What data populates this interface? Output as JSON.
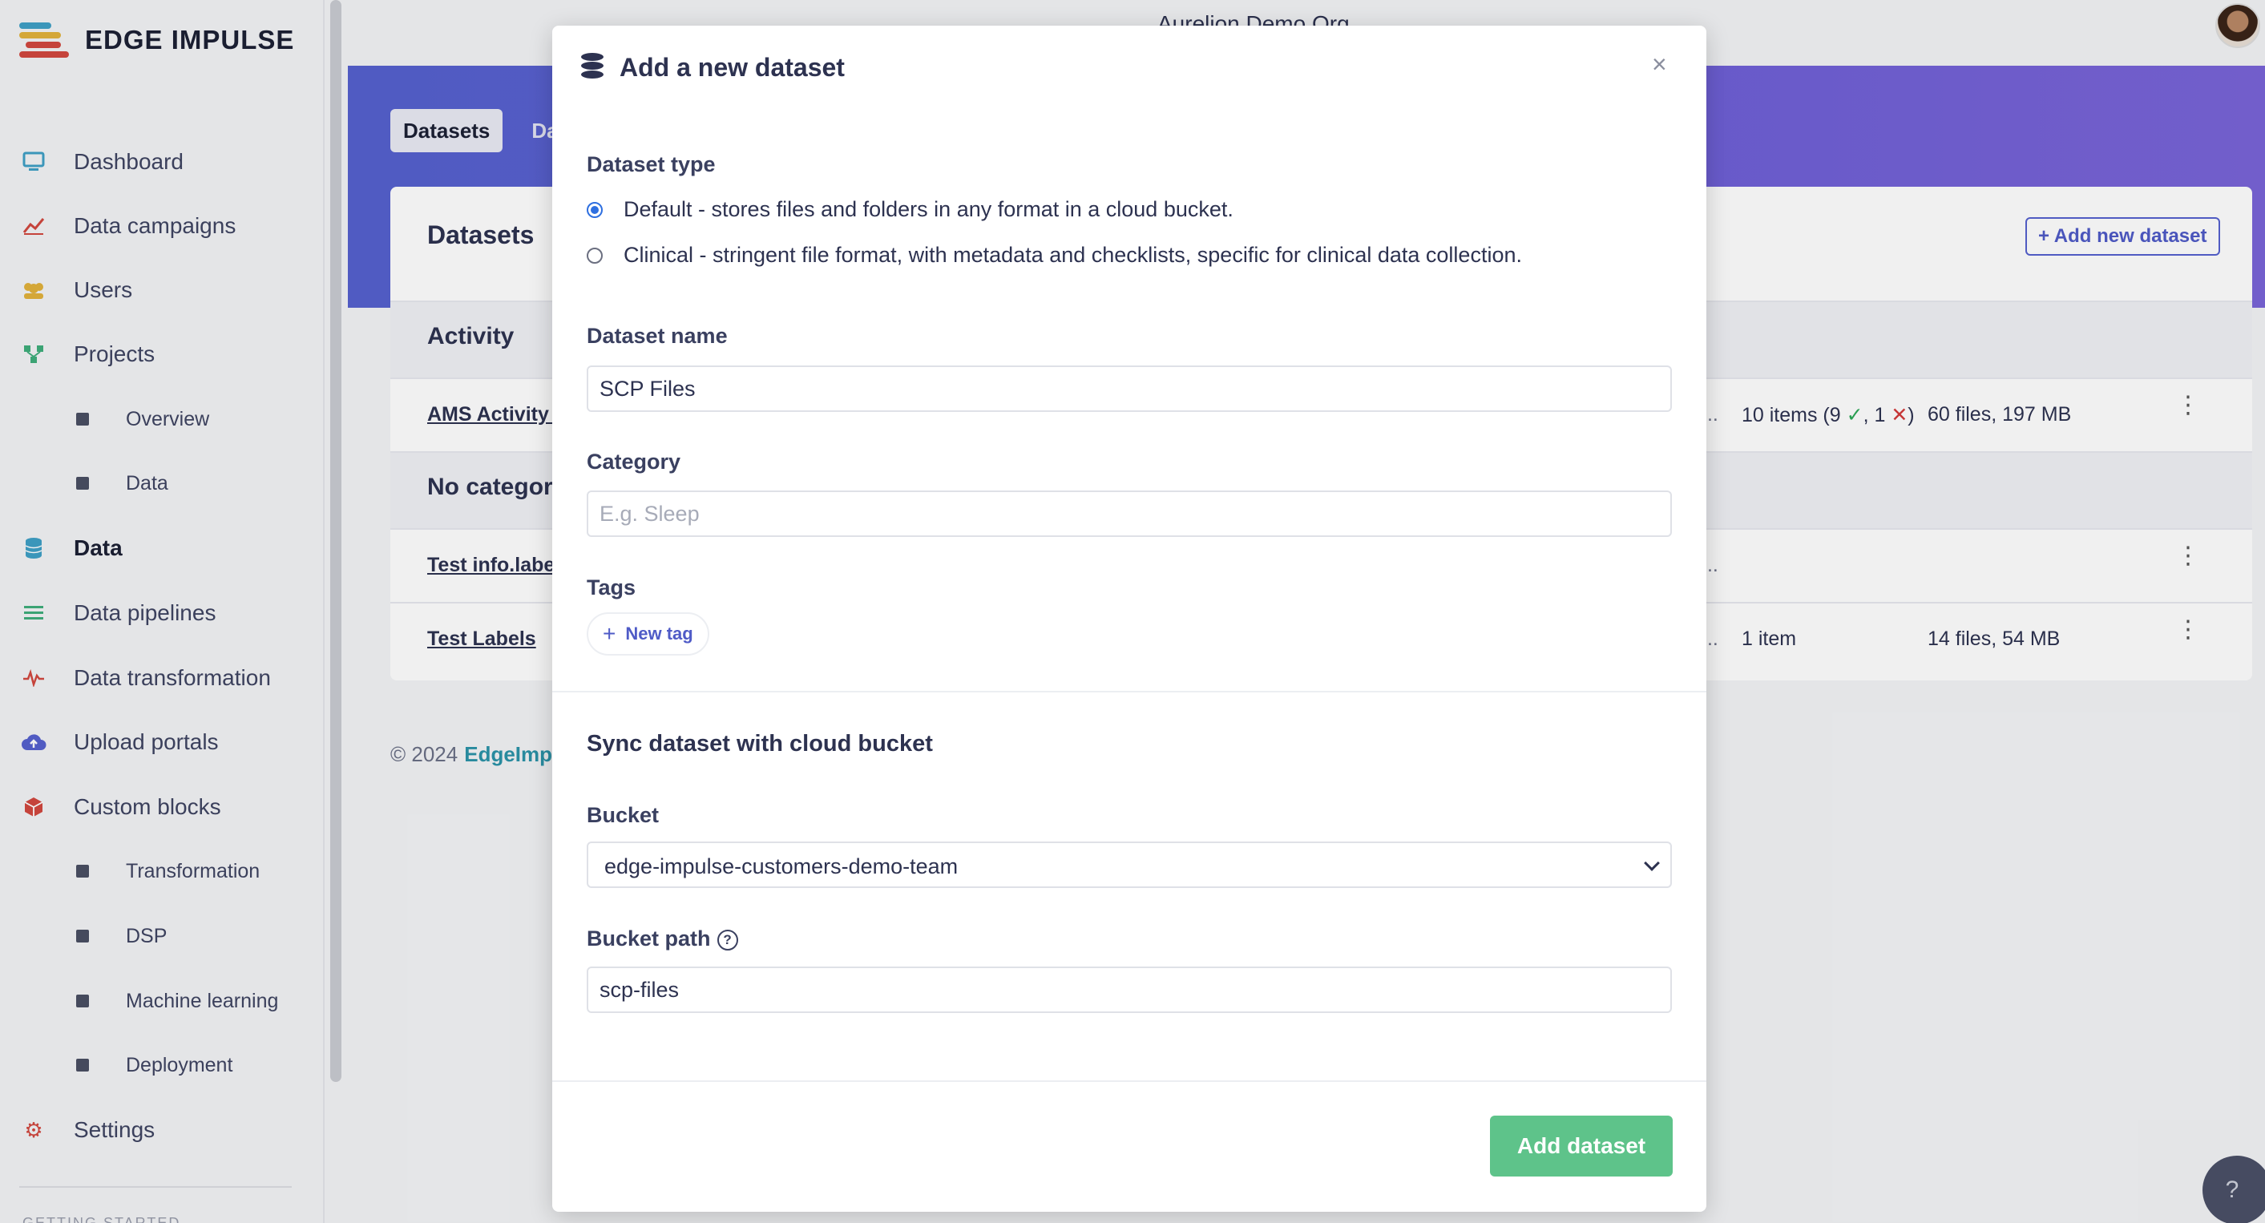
{
  "app": {
    "brand": "EDGE IMPULSE",
    "org_name": "Aurelion Demo Org"
  },
  "sidebar": {
    "items": [
      {
        "label": "Dashboard",
        "icon": "monitor-icon",
        "color": "#3fa0c6"
      },
      {
        "label": "Data campaigns",
        "icon": "line-chart-icon",
        "color": "#d2483f"
      },
      {
        "label": "Users",
        "icon": "users-icon",
        "color": "#e2b23c"
      },
      {
        "label": "Projects",
        "icon": "projects-icon",
        "color": "#3fae7c"
      },
      {
        "label": "Overview"
      },
      {
        "label": "Data"
      },
      {
        "label": "Data",
        "icon": "database-icon",
        "color": "#3fa0c6"
      },
      {
        "label": "Data pipelines",
        "icon": "list-icon",
        "color": "#3fae7c"
      },
      {
        "label": "Data transformation",
        "icon": "pulse-icon",
        "color": "#d2483f"
      },
      {
        "label": "Upload portals",
        "icon": "cloud-upload-icon",
        "color": "#5561cf"
      },
      {
        "label": "Custom blocks",
        "icon": "cube-icon",
        "color": "#d2483f"
      },
      {
        "label": "Transformation"
      },
      {
        "label": "DSP"
      },
      {
        "label": "Machine learning"
      },
      {
        "label": "Deployment"
      },
      {
        "label": "Settings",
        "icon": "gear-icon",
        "color": "#d2483f"
      }
    ],
    "getting_started": "GETTING STARTED"
  },
  "main": {
    "tabs": [
      {
        "label": "Datasets"
      },
      {
        "label": "Da"
      }
    ],
    "card_title": "Datasets",
    "add_new_dataset": "+ Add new dataset",
    "groups": [
      {
        "label": "Activity"
      },
      {
        "label": "No category"
      }
    ],
    "rows": [
      {
        "name": "AMS Activity S",
        "dots": "...",
        "items_prefix": "10 items (9 ",
        "items_ok": "✓",
        "items_sep": ", 1 ",
        "items_bad": "✕",
        "items_suffix": ")",
        "files": "60 files, 197 MB"
      },
      {
        "name": "Test info.label",
        "dots": "...",
        "items_prefix": "",
        "items_ok": "",
        "items_sep": "",
        "items_bad": "",
        "items_suffix": "",
        "files": ""
      },
      {
        "name": "Test Labels",
        "dots": "...",
        "items_prefix": "1 item",
        "items_ok": "",
        "items_sep": "",
        "items_bad": "",
        "items_suffix": "",
        "files": "14 files, 54 MB"
      }
    ],
    "footer_copy": "© 2024",
    "footer_link": "EdgeImp"
  },
  "modal": {
    "title": "Add a new dataset",
    "close": "×",
    "dataset_type_label": "Dataset type",
    "type_options": [
      {
        "label": "Default - stores files and folders in any format in a cloud bucket.",
        "selected": true
      },
      {
        "label": "Clinical - stringent file format, with metadata and checklists, specific for clinical data collection.",
        "selected": false
      }
    ],
    "name_label": "Dataset name",
    "name_value": "SCP Files",
    "category_label": "Category",
    "category_placeholder": "E.g. Sleep",
    "tags_label": "Tags",
    "new_tag": "New tag",
    "sync_title": "Sync dataset with cloud bucket",
    "bucket_label": "Bucket",
    "bucket_value": "edge-impulse-customers-demo-team",
    "bucket_path_label": "Bucket path",
    "bucket_path_value": "scp-files",
    "submit": "Add dataset"
  },
  "colors": {
    "accent": "#5561cf",
    "primary_button": "#5ec38a",
    "link": "#2b93a8"
  }
}
